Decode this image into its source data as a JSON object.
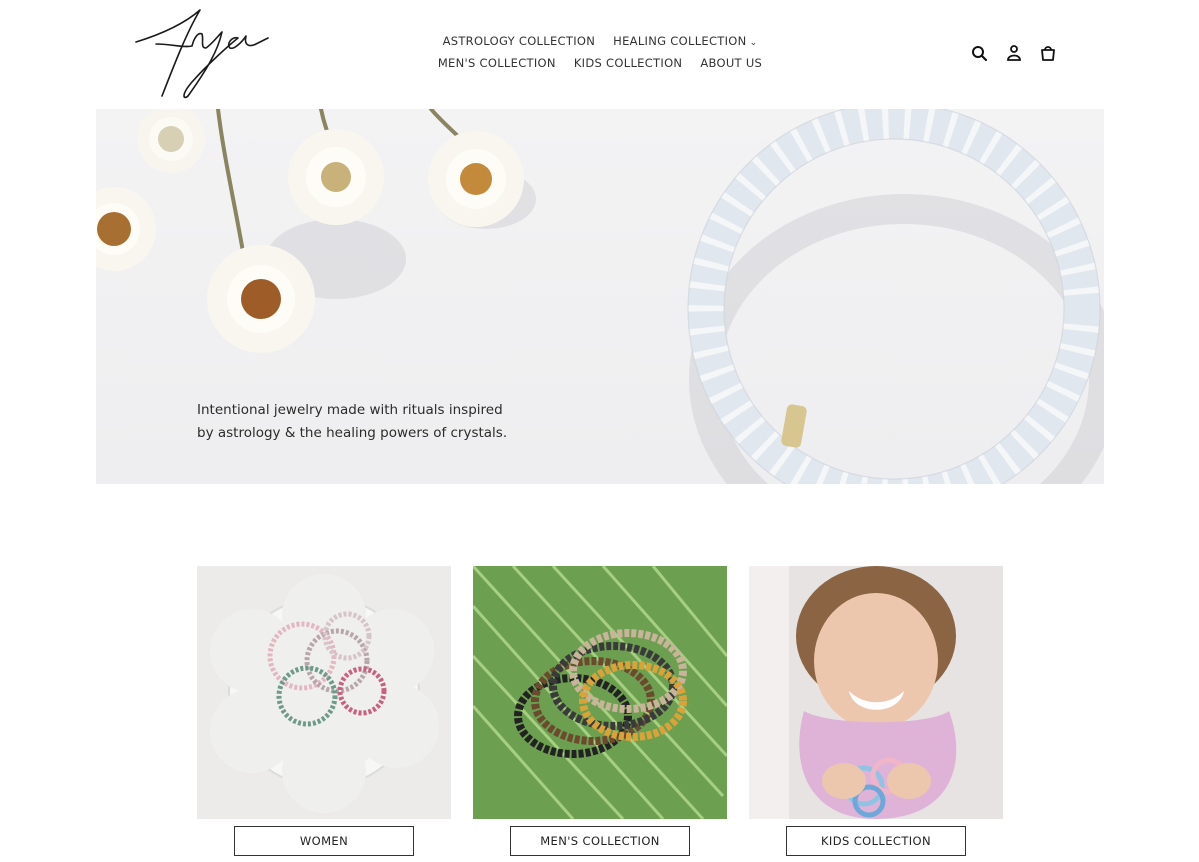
{
  "brand": {
    "logo_text": "Aya"
  },
  "nav": {
    "row1": [
      {
        "label": "ASTROLOGY COLLECTION"
      },
      {
        "label": "HEALING COLLECTION",
        "has_dropdown": true
      }
    ],
    "row2": [
      {
        "label": "MEN'S COLLECTION"
      },
      {
        "label": "KIDS COLLECTION"
      },
      {
        "label": "ABOUT US"
      }
    ]
  },
  "header_icons": [
    "search-icon",
    "account-icon",
    "cart-icon"
  ],
  "hero": {
    "tagline_line1": "Intentional jewelry made with rituals inspired",
    "tagline_line2": "by astrology & the healing powers of crystals."
  },
  "collections": [
    {
      "button": "WOMEN"
    },
    {
      "button": "MEN'S COLLECTION"
    },
    {
      "button": "KIDS COLLECTION"
    }
  ],
  "colors": {
    "text": "#222222",
    "hero_bg": "#f1f1f2",
    "leaf_green": "#5d9a48"
  }
}
